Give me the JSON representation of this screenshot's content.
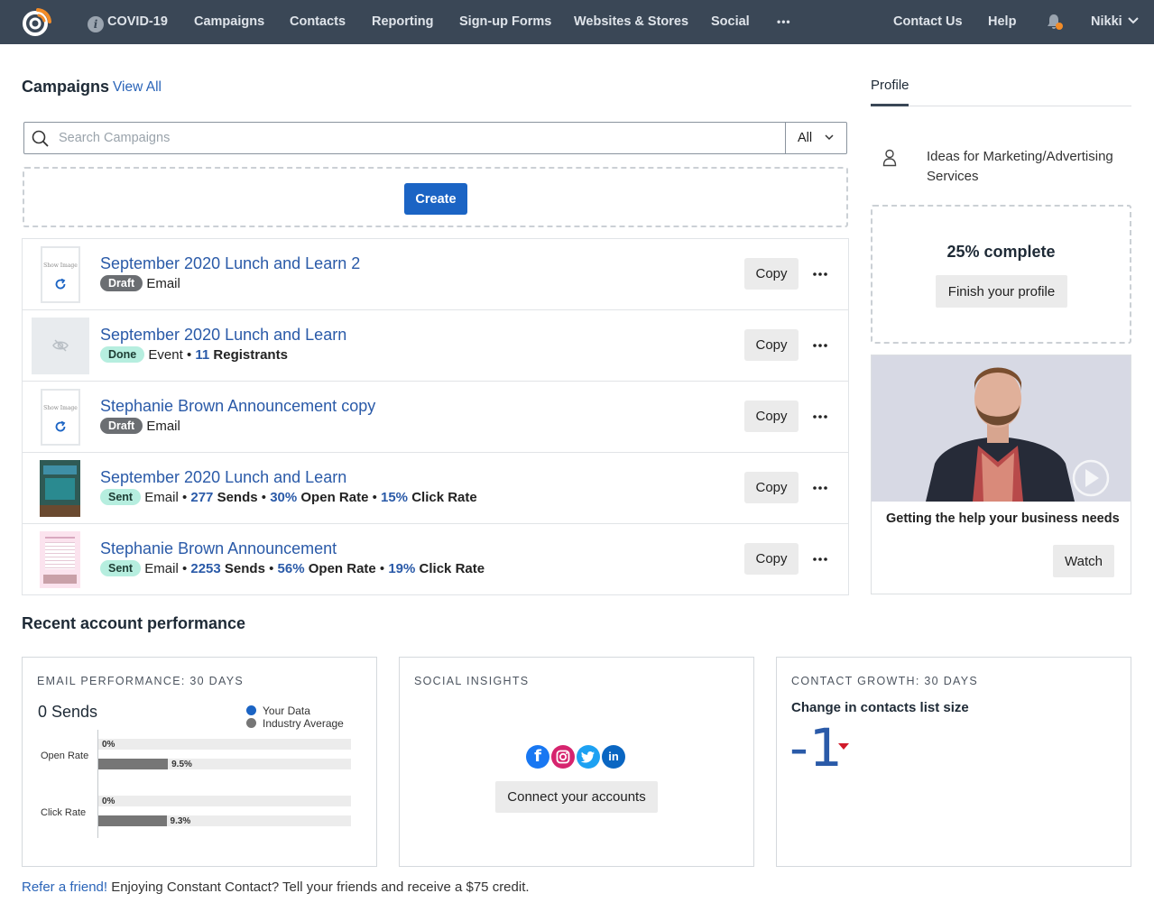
{
  "nav": {
    "items": [
      {
        "label": "COVID-19"
      },
      {
        "label": "Campaigns"
      },
      {
        "label": "Contacts"
      },
      {
        "label": "Reporting"
      },
      {
        "label": "Sign-up Forms"
      },
      {
        "label": "Websites & Stores"
      },
      {
        "label": "Social"
      },
      {
        "label": "•••"
      },
      {
        "label": "Contact Us"
      },
      {
        "label": "Help"
      },
      {
        "label": "Nikki"
      }
    ],
    "info_icon_glyph": "i",
    "bell_dot_color": "#f28c28",
    "bg_color": "#3a4756"
  },
  "campaigns": {
    "title": "Campaigns",
    "view_all": "View All",
    "search_placeholder": "Search Campaigns",
    "filter": "All",
    "create_label": "Create",
    "copy_label": "Copy",
    "thumb_text": "Show Image",
    "rows": [
      {
        "title": "September 2020 Lunch and Learn 2",
        "status": "Draft",
        "type": "Email"
      },
      {
        "title": "September 2020 Lunch and Learn",
        "status": "Done",
        "type": "Event",
        "registrants": "11",
        "registrants_label": "Registrants"
      },
      {
        "title": "Stephanie Brown Announcement copy",
        "status": "Draft",
        "type": "Email"
      },
      {
        "title": "September 2020 Lunch and Learn",
        "status": "Sent",
        "type": "Email",
        "sends": "277",
        "sends_label": "Sends",
        "open_rate": "30%",
        "open_label": "Open Rate",
        "click_rate": "15%",
        "click_label": "Click Rate"
      },
      {
        "title": "Stephanie Brown Announcement",
        "status": "Sent",
        "type": "Email",
        "sends": "2253",
        "sends_label": "Sends",
        "open_rate": "56%",
        "open_label": "Open Rate",
        "click_rate": "19%",
        "click_label": "Click Rate"
      }
    ]
  },
  "profile": {
    "tab": "Profile",
    "ideas": "Ideas for Marketing/Advertising Services",
    "percent_complete": "25% complete",
    "finish_label": "Finish your profile",
    "video_title": "Getting the help your business needs",
    "watch_label": "Watch"
  },
  "performance": {
    "title": "Recent account performance",
    "email": {
      "label": "EMAIL PERFORMANCE: 30 DAYS",
      "sends": "0 Sends",
      "legend_yours": "Your Data",
      "legend_industry": "Industry Average",
      "legend_yours_color": "#1b64c4",
      "legend_industry_color": "#767676",
      "open_label": "Open Rate",
      "click_label": "Click Rate"
    },
    "social": {
      "label": "SOCIAL INSIGHTS",
      "connect_label": "Connect your accounts",
      "icons": [
        "facebook-icon",
        "instagram-icon",
        "twitter-icon",
        "linkedin-icon"
      ]
    },
    "growth": {
      "label": "CONTACT GROWTH: 30 DAYS",
      "subtitle": "Change in contacts list size",
      "value": "-1"
    }
  },
  "chart_data": {
    "type": "bar",
    "categories": [
      "Open Rate",
      "Click Rate"
    ],
    "series": [
      {
        "name": "Your Data",
        "values": [
          0,
          0
        ],
        "labels": [
          "0%",
          "0%"
        ]
      },
      {
        "name": "Industry Average",
        "values": [
          9.5,
          9.3
        ],
        "labels": [
          "9.5%",
          "9.3%"
        ]
      }
    ],
    "xlim": [
      0,
      100
    ]
  },
  "footer": {
    "refer_link": "Refer a friend!",
    "refer_text": " Enjoying Constant Contact? Tell your friends and receive a $75 credit."
  }
}
